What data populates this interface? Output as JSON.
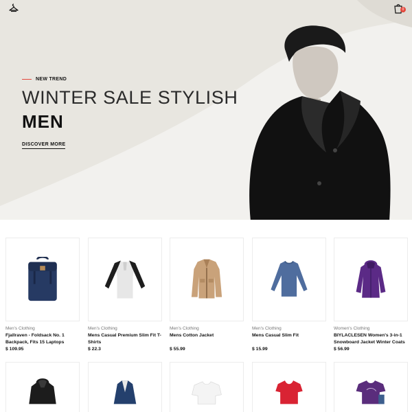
{
  "header": {
    "logo_icon": "hanger-logo-icon",
    "cart_icon": "shopping-bag-icon",
    "cart_count": "0"
  },
  "hero": {
    "eyebrow": "NEW TREND",
    "title": "WINTER SALE STYLISH",
    "subtitle": "MEN",
    "cta": "DISCOVER MORE",
    "accent_color": "#e4473b",
    "background_color": "#e8e6e0"
  },
  "products": [
    {
      "category": "Men's Clothing",
      "name": "Fjallraven - Foldsack No. 1 Backpack, Fits 15 Laptops",
      "price": "$ 109.95",
      "image": "navy-backpack"
    },
    {
      "category": "Men's Clothing",
      "name": "Mens Casual Premium Slim Fit T-Shirts",
      "price": "$ 22.3",
      "image": "raglan-henley-shirt"
    },
    {
      "category": "Men's Clothing",
      "name": "Mens Cotton Jacket",
      "price": "$ 55.99",
      "image": "tan-cotton-jacket"
    },
    {
      "category": "Men's Clothing",
      "name": "Mens Casual Slim Fit",
      "price": "$ 15.99",
      "image": "blue-long-sleeve-tee"
    },
    {
      "category": "Women's Clothing",
      "name": "BIYLACLESEN Women's 3-in-1 Snowboard Jacket Winter Coats",
      "price": "$ 56.99",
      "image": "purple-snowboard-jacket"
    }
  ],
  "products_row2": [
    {
      "image": "black-leather-jacket"
    },
    {
      "image": "navy-denim-jacket"
    },
    {
      "image": "white-blouse"
    },
    {
      "image": "red-tee"
    },
    {
      "image": "purple-print-tee"
    }
  ]
}
